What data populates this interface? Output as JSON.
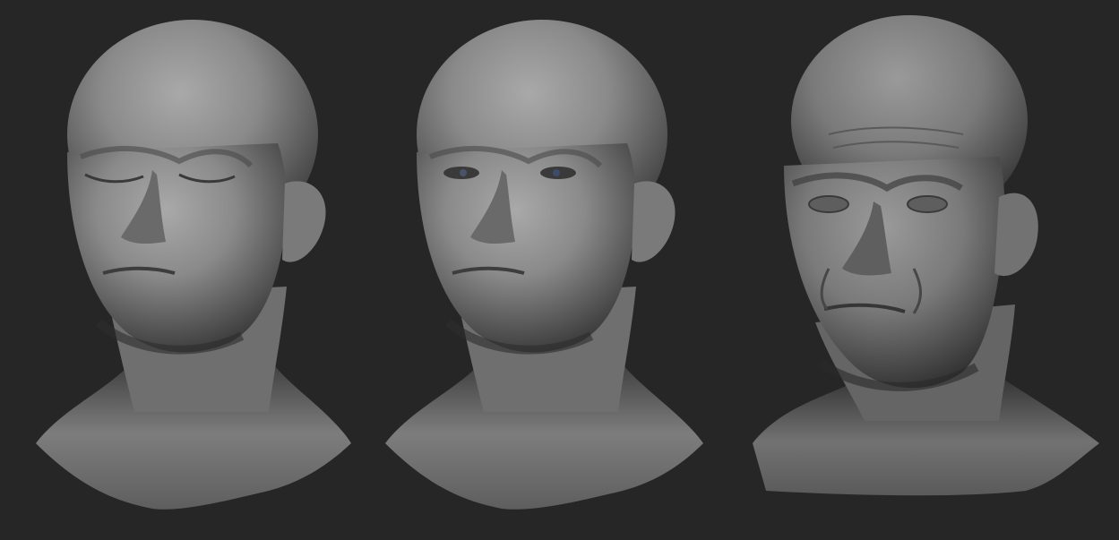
{
  "scene": {
    "background_color": "#262626",
    "clay_color": "#8a8a8a",
    "shadow_color": "#1a1a1a",
    "renders": [
      {
        "name": "bust-eyes-closed",
        "eyes": "closed",
        "sculpt_detail": "smooth"
      },
      {
        "name": "bust-eyes-open",
        "eyes": "open",
        "sculpt_detail": "smooth"
      },
      {
        "name": "bust-detailed",
        "eyes": "hollow",
        "sculpt_detail": "wrinkled"
      }
    ]
  }
}
